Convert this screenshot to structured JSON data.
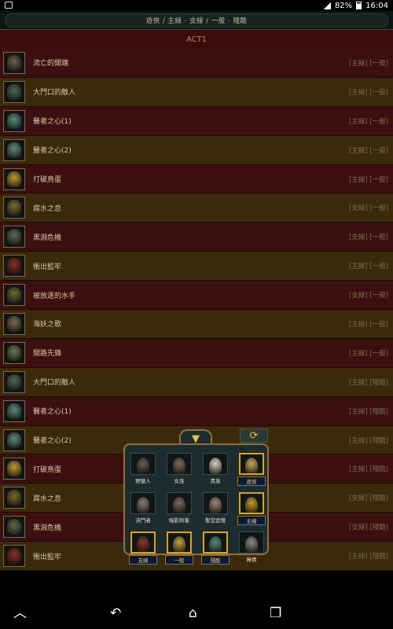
{
  "status": {
    "battery": "82%",
    "time": "16:04"
  },
  "filter": {
    "label": "遊俠 / 主線 · 支線 / 一般 · 殘酷"
  },
  "act": {
    "title": "ACT1"
  },
  "quests": [
    {
      "name": "流亡的開端",
      "tags": "[主線] [一般]",
      "color": "red",
      "icon": "seal-icon"
    },
    {
      "name": "大門口的敵人",
      "tags": "[主線] [一般]",
      "color": "olive",
      "icon": "scarab-icon"
    },
    {
      "name": "醫者之心(1)",
      "tags": "[主線] [一般]",
      "color": "red",
      "icon": "lantern-icon"
    },
    {
      "name": "醫者之心(2)",
      "tags": "[主線] [一般]",
      "color": "olive",
      "icon": "lantern-icon"
    },
    {
      "name": "打破鳥蛋",
      "tags": "[主線] [一般]",
      "color": "red",
      "icon": "orb-icon"
    },
    {
      "name": "腐水之息",
      "tags": "[支線] [一般]",
      "color": "olive",
      "icon": "beast-icon"
    },
    {
      "name": "黑淵危機",
      "tags": "[支線] [一般]",
      "color": "red",
      "icon": "spider-icon"
    },
    {
      "name": "衝出監牢",
      "tags": "[主線] [一般]",
      "color": "olive",
      "icon": "crab-icon"
    },
    {
      "name": "被放逐的水手",
      "tags": "[支線] [一般]",
      "color": "red",
      "icon": "sailor-icon"
    },
    {
      "name": "海妖之歌",
      "tags": "[主線] [一般]",
      "color": "olive",
      "icon": "siren-icon"
    },
    {
      "name": "開路先鋒",
      "tags": "[主線] [一般]",
      "color": "red",
      "icon": "pillar-icon"
    },
    {
      "name": "大門口的敵人",
      "tags": "[主線] [殘酷]",
      "color": "olive",
      "icon": "scarab-icon"
    },
    {
      "name": "醫者之心(1)",
      "tags": "[主線] [殘酷]",
      "color": "red",
      "icon": "lantern-icon"
    },
    {
      "name": "醫者之心(2)",
      "tags": "[主線] [殘酷]",
      "color": "olive",
      "icon": "lantern-icon"
    },
    {
      "name": "打破鳥蛋",
      "tags": "[主線] [殘酷]",
      "color": "red",
      "icon": "orb-icon"
    },
    {
      "name": "腐水之息",
      "tags": "[支線] [殘酷]",
      "color": "olive",
      "icon": "beast-icon"
    },
    {
      "name": "黑淵危機",
      "tags": "[支線] [殘酷]",
      "color": "red",
      "icon": "spider-icon"
    },
    {
      "name": "衝出監牢",
      "tags": "[主線] [殘酷]",
      "color": "olive",
      "icon": "crab-icon"
    }
  ],
  "popup": {
    "filter_icon": "funnel-icon",
    "refresh_icon": "refresh-icon",
    "options": [
      {
        "label": "野蠻人",
        "selected": false,
        "kind": "marauder"
      },
      {
        "label": "女巫",
        "selected": false,
        "kind": "witch"
      },
      {
        "label": "貴族",
        "selected": false,
        "kind": "scion"
      },
      {
        "label": "遊俠",
        "selected": true,
        "kind": "ranger"
      },
      {
        "label": "決鬥者",
        "selected": false,
        "kind": "duelist"
      },
      {
        "label": "暗影刺客",
        "selected": false,
        "kind": "shadow"
      },
      {
        "label": "聖堂武僧",
        "selected": false,
        "kind": "templar"
      },
      {
        "label": "主線",
        "selected": true,
        "kind": "main"
      },
      {
        "label": "支線",
        "selected": true,
        "kind": "side"
      },
      {
        "label": "一般",
        "selected": true,
        "kind": "normal"
      },
      {
        "label": "殘酷",
        "selected": true,
        "kind": "cruel"
      },
      {
        "label": "無情",
        "selected": false,
        "kind": "merciless"
      }
    ]
  },
  "colors": {
    "row_red": "#3d1010",
    "row_olive": "#3a2a0a",
    "accent_gold": "#e0a020"
  }
}
